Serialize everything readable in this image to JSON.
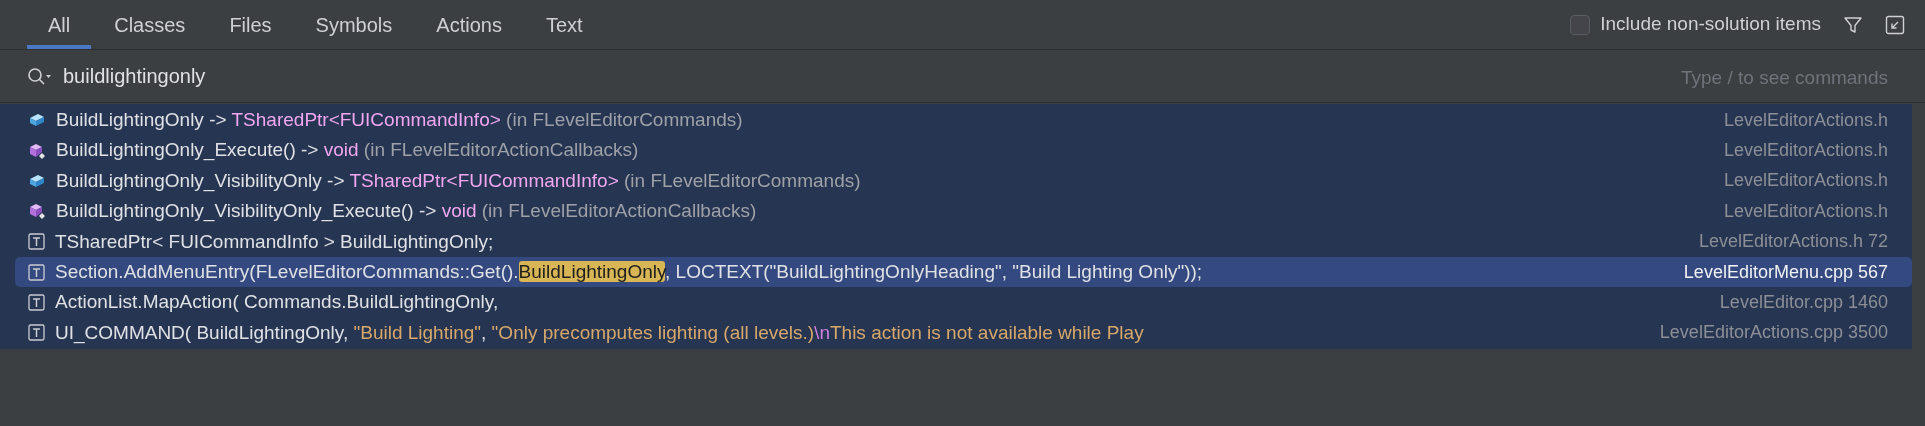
{
  "tabs": [
    {
      "label": "All",
      "selected": true
    },
    {
      "label": "Classes",
      "selected": false
    },
    {
      "label": "Files",
      "selected": false
    },
    {
      "label": "Symbols",
      "selected": false
    },
    {
      "label": "Actions",
      "selected": false
    },
    {
      "label": "Text",
      "selected": false
    }
  ],
  "include_option": {
    "label": "Include non-solution items",
    "checked": false
  },
  "search": {
    "value": "buildlightingonly",
    "hint": "Type / to see commands"
  },
  "results": [
    {
      "kind": "field",
      "selected": false,
      "segments": [
        {
          "kind": "plain",
          "text": "BuildLightingOnly -> "
        },
        {
          "kind": "type",
          "text": "TSharedPtr<FUICommandInfo>"
        },
        {
          "kind": "dim",
          "text": " (in FLevelEditorCommands)"
        }
      ],
      "location": "LevelEditorActions.h"
    },
    {
      "kind": "method",
      "selected": false,
      "segments": [
        {
          "kind": "plain",
          "text": "BuildLightingOnly_Execute() -> "
        },
        {
          "kind": "type",
          "text": "void"
        },
        {
          "kind": "dim",
          "text": " (in FLevelEditorActionCallbacks)"
        }
      ],
      "location": "LevelEditorActions.h"
    },
    {
      "kind": "field",
      "selected": false,
      "segments": [
        {
          "kind": "plain",
          "text": "BuildLightingOnly_VisibilityOnly -> "
        },
        {
          "kind": "type",
          "text": "TSharedPtr<FUICommandInfo>"
        },
        {
          "kind": "dim",
          "text": " (in FLevelEditorCommands)"
        }
      ],
      "location": "LevelEditorActions.h"
    },
    {
      "kind": "method",
      "selected": false,
      "segments": [
        {
          "kind": "plain",
          "text": "BuildLightingOnly_VisibilityOnly_Execute() -> "
        },
        {
          "kind": "type",
          "text": "void"
        },
        {
          "kind": "dim",
          "text": " (in FLevelEditorActionCallbacks)"
        }
      ],
      "location": "LevelEditorActions.h"
    },
    {
      "kind": "text",
      "selected": false,
      "segments": [
        {
          "kind": "plain",
          "text": "TSharedPtr< FUICommandInfo > BuildLightingOnly;"
        }
      ],
      "location": "LevelEditorActions.h 72"
    },
    {
      "kind": "text",
      "selected": true,
      "segments": [
        {
          "kind": "plain",
          "text": "Section.AddMenuEntry(FLevelEditorCommands::Get()."
        },
        {
          "kind": "match",
          "text": "BuildLightingOnly"
        },
        {
          "kind": "plain",
          "text": ", LOCTEXT(\"BuildLightingOnlyHeading\", \"Build Lighting Only\"));"
        }
      ],
      "location": "LevelEditorMenu.cpp 567"
    },
    {
      "kind": "text",
      "selected": false,
      "segments": [
        {
          "kind": "plain",
          "text": "ActionList.MapAction( Commands.BuildLightingOnly,"
        }
      ],
      "location": "LevelEditor.cpp 1460"
    },
    {
      "kind": "text",
      "selected": false,
      "segments": [
        {
          "kind": "plain",
          "text": "UI_COMMAND( BuildLightingOnly, "
        },
        {
          "kind": "string",
          "text": "\"Build Lighting\""
        },
        {
          "kind": "plain",
          "text": ", "
        },
        {
          "kind": "string",
          "text": "\"Only precomputes lighting (all levels.)"
        },
        {
          "kind": "escape",
          "text": "\\n"
        },
        {
          "kind": "string",
          "text": "This action is not available while Play"
        }
      ],
      "location": "LevelEditorActions.cpp 3500"
    }
  ]
}
